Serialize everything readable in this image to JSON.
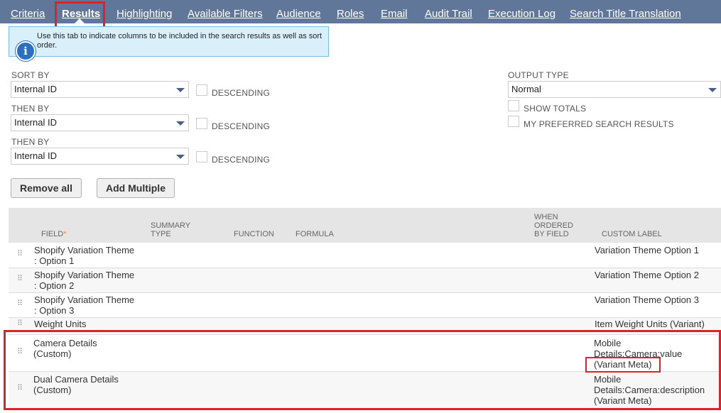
{
  "tabs": [
    {
      "label": "Criteria",
      "active": false
    },
    {
      "label": "Results",
      "active": true
    },
    {
      "label": "Highlighting",
      "active": false
    },
    {
      "label": "Available Filters",
      "active": false
    },
    {
      "label": "Audience",
      "active": false
    },
    {
      "label": "Roles",
      "active": false
    },
    {
      "label": "Email",
      "active": false
    },
    {
      "label": "Audit Trail",
      "active": false
    },
    {
      "label": "Execution Log",
      "active": false
    },
    {
      "label": "Search Title Translation",
      "active": false
    }
  ],
  "info": {
    "text": "Use this tab to indicate columns to be included in the search results as well as sort order.",
    "icon": "info-icon"
  },
  "sort": {
    "sort_by_label": "SORT BY",
    "sort_by_value": "Internal ID",
    "then_by_label": "THEN BY",
    "then_by_value_1": "Internal ID",
    "then_by_value_2": "Internal ID",
    "descending_label": "DESCENDING"
  },
  "output": {
    "type_label": "OUTPUT TYPE",
    "type_value": "Normal",
    "show_totals_label": "SHOW TOTALS",
    "preferred_label": "MY PREFERRED SEARCH RESULTS"
  },
  "buttons": {
    "remove_all": "Remove all",
    "add_multiple": "Add Multiple"
  },
  "table": {
    "headers": {
      "field": "FIELD",
      "required_mark": "*",
      "summary_type": "SUMMARY\nTYPE",
      "function": "FUNCTION",
      "formula": "FORMULA",
      "when_ordered": "WHEN\nORDERED\nBY FIELD",
      "custom_label": "CUSTOM LABEL"
    },
    "rows": [
      {
        "field": "Shopify Variation Theme\n: Option 1",
        "custom_label": "Variation Theme Option 1"
      },
      {
        "field": "Shopify Variation Theme\n: Option 2",
        "custom_label": "Variation Theme Option 2"
      },
      {
        "field": "Shopify Variation Theme\n: Option 3",
        "custom_label": "Variation Theme Option 3"
      },
      {
        "field": "Weight Units",
        "custom_label": "Item Weight Units (Variant)"
      },
      {
        "field": "Camera Details\n(Custom)",
        "custom_label": "Mobile\nDetails:Camera:value\n(Variant Meta)"
      },
      {
        "field": "Dual Camera Details\n(Custom)",
        "custom_label": "Mobile\nDetails:Camera:description\n(Variant Meta)"
      }
    ]
  },
  "colors": {
    "tab_bar": "#607799",
    "highlight": "#e0202a",
    "info_bg": "#d9f0fb"
  }
}
